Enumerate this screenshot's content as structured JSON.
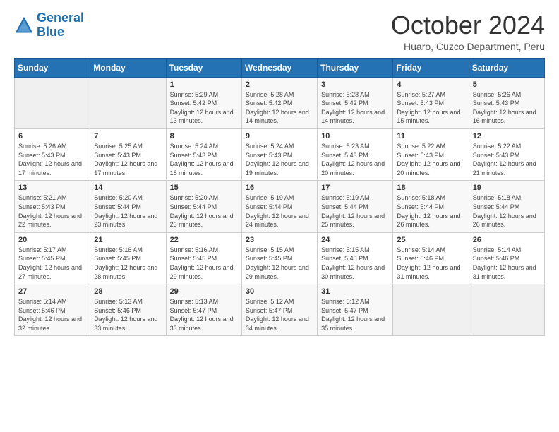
{
  "logo": {
    "line1": "General",
    "line2": "Blue"
  },
  "header": {
    "month": "October 2024",
    "location": "Huaro, Cuzco Department, Peru"
  },
  "days_of_week": [
    "Sunday",
    "Monday",
    "Tuesday",
    "Wednesday",
    "Thursday",
    "Friday",
    "Saturday"
  ],
  "weeks": [
    [
      {
        "day": "",
        "sunrise": "",
        "sunset": "",
        "daylight": ""
      },
      {
        "day": "",
        "sunrise": "",
        "sunset": "",
        "daylight": ""
      },
      {
        "day": "1",
        "sunrise": "Sunrise: 5:29 AM",
        "sunset": "Sunset: 5:42 PM",
        "daylight": "Daylight: 12 hours and 13 minutes."
      },
      {
        "day": "2",
        "sunrise": "Sunrise: 5:28 AM",
        "sunset": "Sunset: 5:42 PM",
        "daylight": "Daylight: 12 hours and 14 minutes."
      },
      {
        "day": "3",
        "sunrise": "Sunrise: 5:28 AM",
        "sunset": "Sunset: 5:42 PM",
        "daylight": "Daylight: 12 hours and 14 minutes."
      },
      {
        "day": "4",
        "sunrise": "Sunrise: 5:27 AM",
        "sunset": "Sunset: 5:43 PM",
        "daylight": "Daylight: 12 hours and 15 minutes."
      },
      {
        "day": "5",
        "sunrise": "Sunrise: 5:26 AM",
        "sunset": "Sunset: 5:43 PM",
        "daylight": "Daylight: 12 hours and 16 minutes."
      }
    ],
    [
      {
        "day": "6",
        "sunrise": "Sunrise: 5:26 AM",
        "sunset": "Sunset: 5:43 PM",
        "daylight": "Daylight: 12 hours and 17 minutes."
      },
      {
        "day": "7",
        "sunrise": "Sunrise: 5:25 AM",
        "sunset": "Sunset: 5:43 PM",
        "daylight": "Daylight: 12 hours and 17 minutes."
      },
      {
        "day": "8",
        "sunrise": "Sunrise: 5:24 AM",
        "sunset": "Sunset: 5:43 PM",
        "daylight": "Daylight: 12 hours and 18 minutes."
      },
      {
        "day": "9",
        "sunrise": "Sunrise: 5:24 AM",
        "sunset": "Sunset: 5:43 PM",
        "daylight": "Daylight: 12 hours and 19 minutes."
      },
      {
        "day": "10",
        "sunrise": "Sunrise: 5:23 AM",
        "sunset": "Sunset: 5:43 PM",
        "daylight": "Daylight: 12 hours and 20 minutes."
      },
      {
        "day": "11",
        "sunrise": "Sunrise: 5:22 AM",
        "sunset": "Sunset: 5:43 PM",
        "daylight": "Daylight: 12 hours and 20 minutes."
      },
      {
        "day": "12",
        "sunrise": "Sunrise: 5:22 AM",
        "sunset": "Sunset: 5:43 PM",
        "daylight": "Daylight: 12 hours and 21 minutes."
      }
    ],
    [
      {
        "day": "13",
        "sunrise": "Sunrise: 5:21 AM",
        "sunset": "Sunset: 5:43 PM",
        "daylight": "Daylight: 12 hours and 22 minutes."
      },
      {
        "day": "14",
        "sunrise": "Sunrise: 5:20 AM",
        "sunset": "Sunset: 5:44 PM",
        "daylight": "Daylight: 12 hours and 23 minutes."
      },
      {
        "day": "15",
        "sunrise": "Sunrise: 5:20 AM",
        "sunset": "Sunset: 5:44 PM",
        "daylight": "Daylight: 12 hours and 23 minutes."
      },
      {
        "day": "16",
        "sunrise": "Sunrise: 5:19 AM",
        "sunset": "Sunset: 5:44 PM",
        "daylight": "Daylight: 12 hours and 24 minutes."
      },
      {
        "day": "17",
        "sunrise": "Sunrise: 5:19 AM",
        "sunset": "Sunset: 5:44 PM",
        "daylight": "Daylight: 12 hours and 25 minutes."
      },
      {
        "day": "18",
        "sunrise": "Sunrise: 5:18 AM",
        "sunset": "Sunset: 5:44 PM",
        "daylight": "Daylight: 12 hours and 26 minutes."
      },
      {
        "day": "19",
        "sunrise": "Sunrise: 5:18 AM",
        "sunset": "Sunset: 5:44 PM",
        "daylight": "Daylight: 12 hours and 26 minutes."
      }
    ],
    [
      {
        "day": "20",
        "sunrise": "Sunrise: 5:17 AM",
        "sunset": "Sunset: 5:45 PM",
        "daylight": "Daylight: 12 hours and 27 minutes."
      },
      {
        "day": "21",
        "sunrise": "Sunrise: 5:16 AM",
        "sunset": "Sunset: 5:45 PM",
        "daylight": "Daylight: 12 hours and 28 minutes."
      },
      {
        "day": "22",
        "sunrise": "Sunrise: 5:16 AM",
        "sunset": "Sunset: 5:45 PM",
        "daylight": "Daylight: 12 hours and 29 minutes."
      },
      {
        "day": "23",
        "sunrise": "Sunrise: 5:15 AM",
        "sunset": "Sunset: 5:45 PM",
        "daylight": "Daylight: 12 hours and 29 minutes."
      },
      {
        "day": "24",
        "sunrise": "Sunrise: 5:15 AM",
        "sunset": "Sunset: 5:45 PM",
        "daylight": "Daylight: 12 hours and 30 minutes."
      },
      {
        "day": "25",
        "sunrise": "Sunrise: 5:14 AM",
        "sunset": "Sunset: 5:46 PM",
        "daylight": "Daylight: 12 hours and 31 minutes."
      },
      {
        "day": "26",
        "sunrise": "Sunrise: 5:14 AM",
        "sunset": "Sunset: 5:46 PM",
        "daylight": "Daylight: 12 hours and 31 minutes."
      }
    ],
    [
      {
        "day": "27",
        "sunrise": "Sunrise: 5:14 AM",
        "sunset": "Sunset: 5:46 PM",
        "daylight": "Daylight: 12 hours and 32 minutes."
      },
      {
        "day": "28",
        "sunrise": "Sunrise: 5:13 AM",
        "sunset": "Sunset: 5:46 PM",
        "daylight": "Daylight: 12 hours and 33 minutes."
      },
      {
        "day": "29",
        "sunrise": "Sunrise: 5:13 AM",
        "sunset": "Sunset: 5:47 PM",
        "daylight": "Daylight: 12 hours and 33 minutes."
      },
      {
        "day": "30",
        "sunrise": "Sunrise: 5:12 AM",
        "sunset": "Sunset: 5:47 PM",
        "daylight": "Daylight: 12 hours and 34 minutes."
      },
      {
        "day": "31",
        "sunrise": "Sunrise: 5:12 AM",
        "sunset": "Sunset: 5:47 PM",
        "daylight": "Daylight: 12 hours and 35 minutes."
      },
      {
        "day": "",
        "sunrise": "",
        "sunset": "",
        "daylight": ""
      },
      {
        "day": "",
        "sunrise": "",
        "sunset": "",
        "daylight": ""
      }
    ]
  ]
}
